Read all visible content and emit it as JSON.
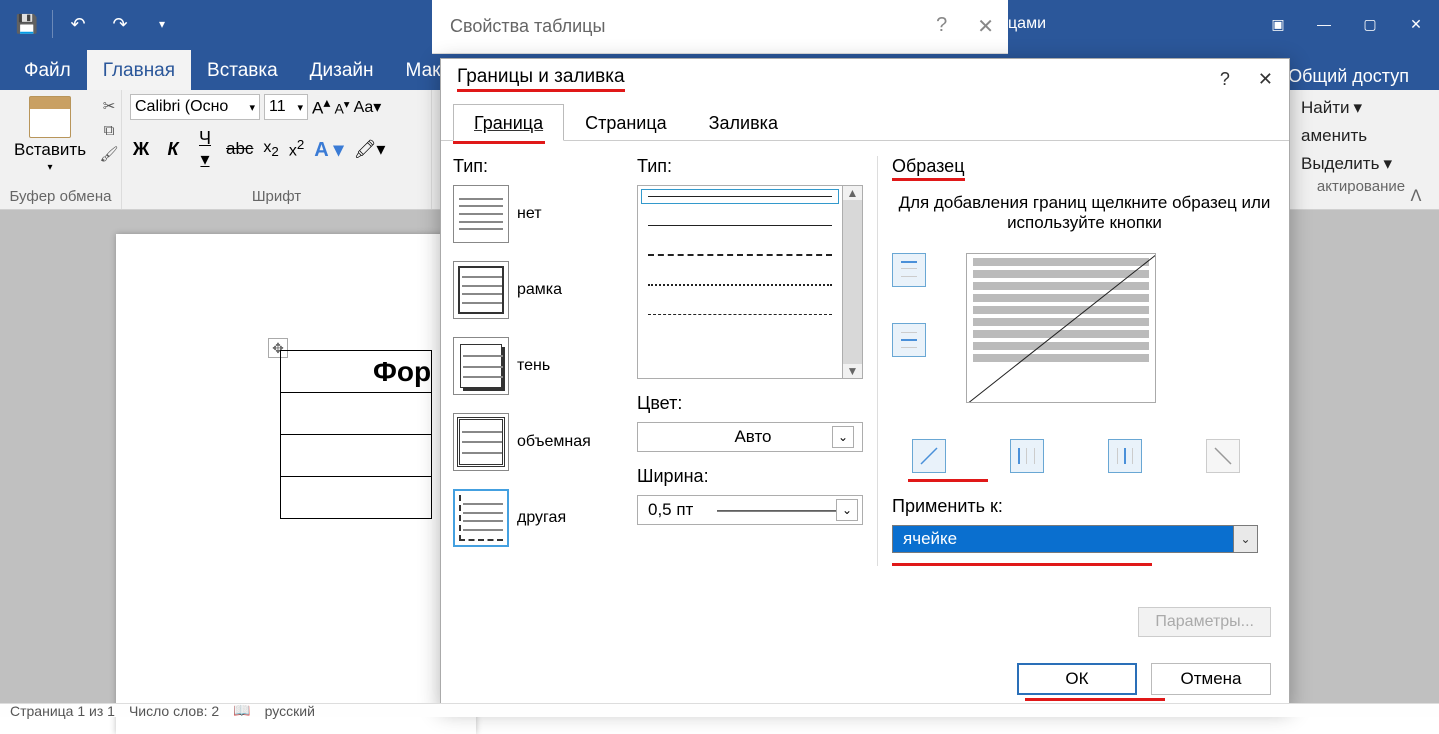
{
  "titlebar": {
    "strip_text": "цами"
  },
  "tabs": {
    "file": "Файл",
    "home": "Главная",
    "insert": "Вставка",
    "design": "Дизайн",
    "layout": "Макет"
  },
  "share": "Общий доступ",
  "ribbon": {
    "clipboard": {
      "paste": "Вставить",
      "group": "Буфер обмена"
    },
    "font": {
      "name": "Calibri (Осно",
      "size": "11",
      "group": "Шрифт"
    },
    "editing": {
      "find": "Найти",
      "replace": "аменить",
      "select": "Выделить",
      "group": "актирование"
    }
  },
  "doc": {
    "cell_text": "Фор"
  },
  "statusbar": {
    "page": "Страница 1 из 1",
    "words": "Число слов: 2",
    "lang": "русский"
  },
  "tblprops_dialog": {
    "title": "Свойства таблицы"
  },
  "dialog": {
    "title": "Границы и заливка",
    "tabs": {
      "border": "Граница",
      "page": "Страница",
      "fill": "Заливка"
    },
    "type_label": "Тип:",
    "types": {
      "none": "нет",
      "box": "рамка",
      "shadow": "тень",
      "threeD": "объемная",
      "custom": "другая"
    },
    "style_label": "Тип:",
    "color_label": "Цвет:",
    "color_value": "Авто",
    "width_label": "Ширина:",
    "width_value": "0,5 пт",
    "preview_label": "Образец",
    "preview_help": "Для добавления границ щелкните образец или используйте кнопки",
    "apply_label": "Применить к:",
    "apply_value": "ячейке",
    "params": "Параметры...",
    "ok": "ОК",
    "cancel": "Отмена"
  }
}
